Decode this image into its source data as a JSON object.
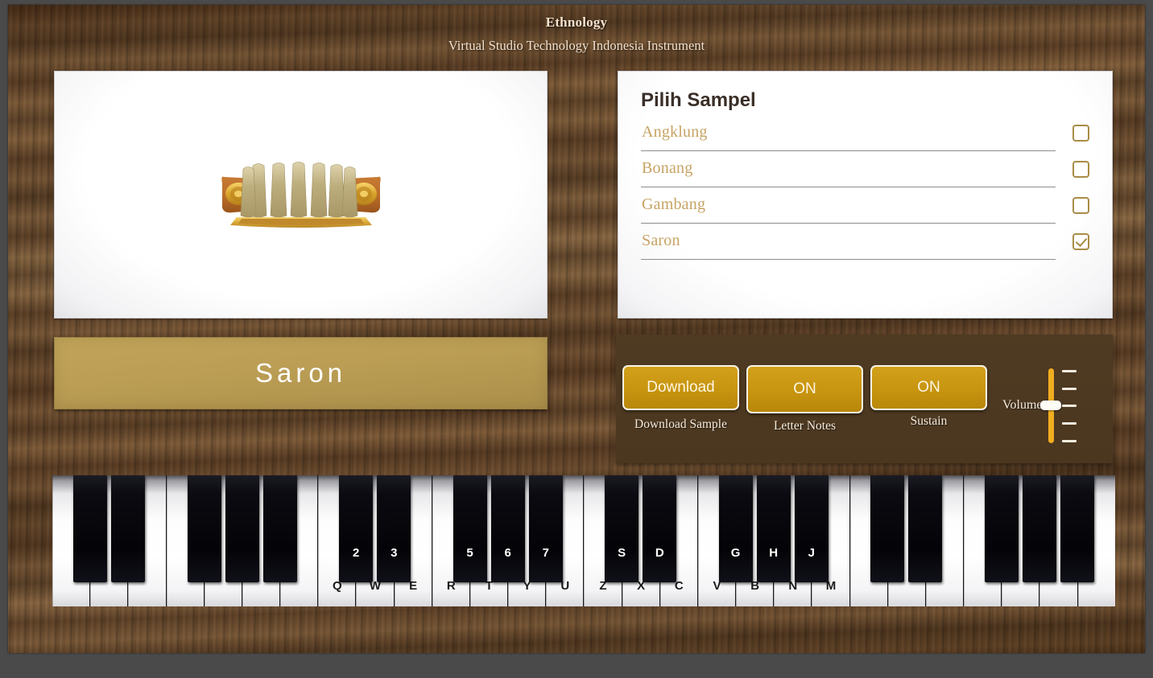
{
  "header": {
    "title": "Ethnology",
    "subtitle": "Virtual Studio Technology Indonesia Instrument"
  },
  "instrument": {
    "name": "Saron",
    "image_alt": "saron-gamelan-instrument"
  },
  "sample_panel": {
    "title": "Pilih Sampel",
    "items": [
      {
        "label": "Angklung",
        "checked": false
      },
      {
        "label": "Bonang",
        "checked": false
      },
      {
        "label": "Gambang",
        "checked": false
      },
      {
        "label": "Saron",
        "checked": true
      }
    ]
  },
  "controls": {
    "download": {
      "button": "Download",
      "caption": "Download Sample"
    },
    "letter_notes": {
      "button": "ON",
      "caption": "Letter Notes"
    },
    "sustain": {
      "button": "ON",
      "caption": "Sustain"
    },
    "volume": {
      "label": "Volume",
      "value": 50,
      "ticks": 5
    }
  },
  "keyboard": {
    "white_keys": [
      {
        "label": ""
      },
      {
        "label": ""
      },
      {
        "label": ""
      },
      {
        "label": ""
      },
      {
        "label": ""
      },
      {
        "label": ""
      },
      {
        "label": ""
      },
      {
        "label": "Q"
      },
      {
        "label": "W"
      },
      {
        "label": "E"
      },
      {
        "label": "R"
      },
      {
        "label": "T"
      },
      {
        "label": "Y"
      },
      {
        "label": "U"
      },
      {
        "label": "Z"
      },
      {
        "label": "X"
      },
      {
        "label": "C"
      },
      {
        "label": "V"
      },
      {
        "label": "B"
      },
      {
        "label": "N"
      },
      {
        "label": "M"
      },
      {
        "label": ""
      },
      {
        "label": ""
      },
      {
        "label": ""
      },
      {
        "label": ""
      },
      {
        "label": ""
      },
      {
        "label": ""
      },
      {
        "label": ""
      }
    ],
    "black_keys": [
      {
        "label": "",
        "white_index": 0
      },
      {
        "label": "",
        "white_index": 1
      },
      {
        "label": "",
        "white_index": 3
      },
      {
        "label": "",
        "white_index": 4
      },
      {
        "label": "",
        "white_index": 5
      },
      {
        "label": "2",
        "white_index": 7
      },
      {
        "label": "3",
        "white_index": 8
      },
      {
        "label": "5",
        "white_index": 10
      },
      {
        "label": "6",
        "white_index": 11
      },
      {
        "label": "7",
        "white_index": 12
      },
      {
        "label": "S",
        "white_index": 14
      },
      {
        "label": "D",
        "white_index": 15
      },
      {
        "label": "G",
        "white_index": 17
      },
      {
        "label": "H",
        "white_index": 18
      },
      {
        "label": "J",
        "white_index": 19
      },
      {
        "label": "",
        "white_index": 21
      },
      {
        "label": "",
        "white_index": 22
      },
      {
        "label": "",
        "white_index": 24
      },
      {
        "label": "",
        "white_index": 25
      },
      {
        "label": "",
        "white_index": 26
      }
    ]
  },
  "colors": {
    "gold_button": "#c7950f",
    "panel_brown": "#4b3720",
    "name_bar": "#bb9e54",
    "list_text": "#c7a363",
    "slider": "#f0ad1f",
    "page_bg": "#4a4a4a"
  }
}
